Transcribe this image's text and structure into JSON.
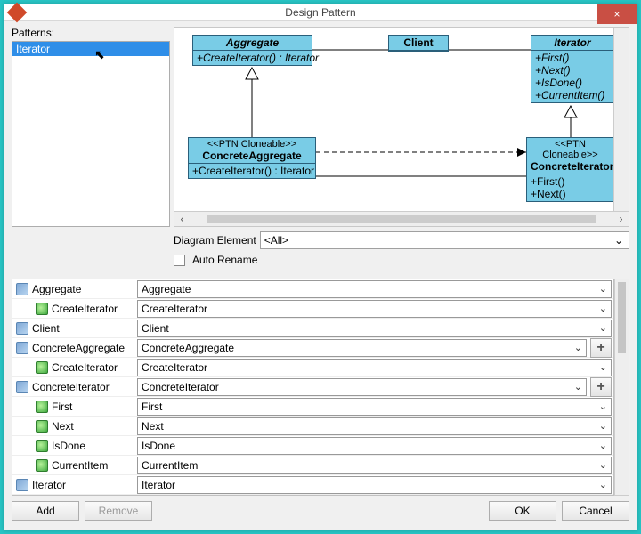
{
  "title": "Design Pattern",
  "close": "×",
  "patterns_label": "Patterns:",
  "patterns": {
    "items": [
      "Iterator"
    ]
  },
  "diagram": {
    "aggregate": {
      "name": "Aggregate",
      "op": "+CreateIterator() : Iterator"
    },
    "client": {
      "name": "Client"
    },
    "iterator": {
      "name": "Iterator",
      "ops": [
        "+First()",
        "+Next()",
        "+IsDone()",
        "+CurrentItem()"
      ]
    },
    "concreteAggregate": {
      "stereo": "<<PTN Cloneable>>",
      "name": "ConcreteAggregate",
      "op": "+CreateIterator() : Iterator"
    },
    "concreteIterator": {
      "stereo": "<<PTN Cloneable>>",
      "name": "ConcreteIterator",
      "ops": [
        "+First()",
        "+Next()"
      ]
    }
  },
  "mid": {
    "diagram_element_label": "Diagram Element",
    "diagram_element_value": "<All>",
    "auto_rename_label": "Auto Rename"
  },
  "props": [
    {
      "icon": "class",
      "name": "Aggregate",
      "value": "Aggregate",
      "indent": 0
    },
    {
      "icon": "op",
      "name": "CreateIterator",
      "value": "CreateIterator",
      "indent": 1
    },
    {
      "icon": "class",
      "name": "Client",
      "value": "Client",
      "indent": 0
    },
    {
      "icon": "class",
      "name": "ConcreteAggregate",
      "value": "ConcreteAggregate",
      "indent": 0,
      "add": true
    },
    {
      "icon": "op",
      "name": "CreateIterator",
      "value": "CreateIterator",
      "indent": 1
    },
    {
      "icon": "class",
      "name": "ConcreteIterator",
      "value": "ConcreteIterator",
      "indent": 0,
      "add": true
    },
    {
      "icon": "op",
      "name": "First",
      "value": "First",
      "indent": 1
    },
    {
      "icon": "op",
      "name": "Next",
      "value": "Next",
      "indent": 1
    },
    {
      "icon": "op",
      "name": "IsDone",
      "value": "IsDone",
      "indent": 1
    },
    {
      "icon": "op",
      "name": "CurrentItem",
      "value": "CurrentItem",
      "indent": 1
    },
    {
      "icon": "class",
      "name": "Iterator",
      "value": "Iterator",
      "indent": 0
    }
  ],
  "buttons": {
    "add": "Add",
    "remove": "Remove",
    "ok": "OK",
    "cancel": "Cancel",
    "plus": "+"
  }
}
